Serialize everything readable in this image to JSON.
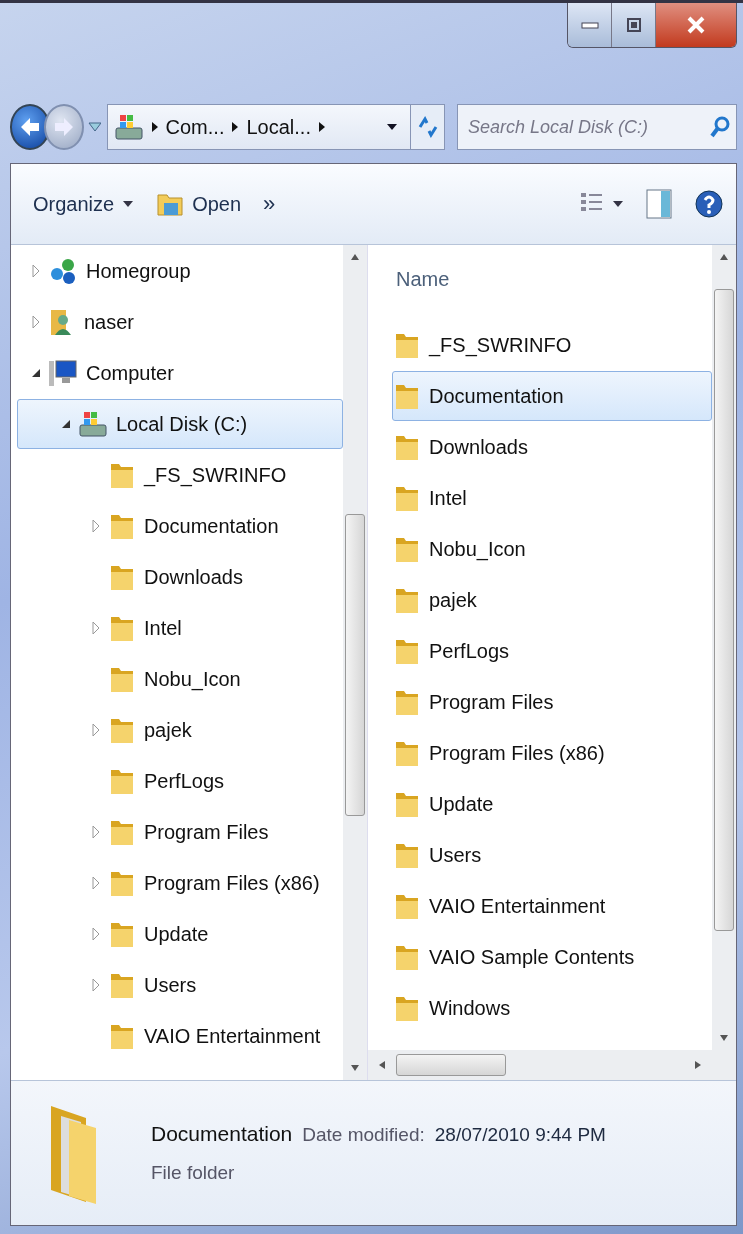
{
  "address_bar": {
    "crumbs": [
      "Com...",
      "Local..."
    ]
  },
  "search": {
    "placeholder": "Search Local Disk (C:)"
  },
  "toolbar": {
    "organize": "Organize",
    "open": "Open",
    "more": "»"
  },
  "tree": [
    {
      "name": "Homegroup",
      "kind": "homegroup",
      "expandable": true,
      "expanded": false,
      "selected": false
    },
    {
      "name": "naser",
      "kind": "user",
      "expandable": true,
      "expanded": false,
      "selected": false
    },
    {
      "name": "Computer",
      "kind": "computer",
      "expandable": true,
      "expanded": true,
      "selected": false,
      "children": [
        {
          "name": "Local Disk (C:)",
          "kind": "drive",
          "expandable": true,
          "expanded": true,
          "selected": true,
          "children": [
            {
              "name": "_FS_SWRINFO",
              "kind": "folder",
              "expandable": false,
              "expanded": false,
              "selected": false
            },
            {
              "name": "Documentation",
              "kind": "folder",
              "expandable": true,
              "expanded": false,
              "selected": false
            },
            {
              "name": "Downloads",
              "kind": "folder",
              "expandable": false,
              "expanded": false,
              "selected": false
            },
            {
              "name": "Intel",
              "kind": "folder",
              "expandable": true,
              "expanded": false,
              "selected": false
            },
            {
              "name": "Nobu_Icon",
              "kind": "folder",
              "expandable": false,
              "expanded": false,
              "selected": false
            },
            {
              "name": "pajek",
              "kind": "folder",
              "expandable": true,
              "expanded": false,
              "selected": false
            },
            {
              "name": "PerfLogs",
              "kind": "folder",
              "expandable": false,
              "expanded": false,
              "selected": false
            },
            {
              "name": "Program Files",
              "kind": "folder",
              "expandable": true,
              "expanded": false,
              "selected": false
            },
            {
              "name": "Program Files (x86)",
              "kind": "folder",
              "expandable": true,
              "expanded": false,
              "selected": false
            },
            {
              "name": "Update",
              "kind": "folder",
              "expandable": true,
              "expanded": false,
              "selected": false
            },
            {
              "name": "Users",
              "kind": "folder",
              "expandable": true,
              "expanded": false,
              "selected": false
            },
            {
              "name": "VAIO Entertainment",
              "kind": "folder",
              "expandable": false,
              "expanded": false,
              "selected": false
            }
          ]
        }
      ]
    }
  ],
  "file_list": {
    "column": "Name",
    "items": [
      {
        "name": "_FS_SWRINFO",
        "selected": false
      },
      {
        "name": "Documentation",
        "selected": true
      },
      {
        "name": "Downloads",
        "selected": false
      },
      {
        "name": "Intel",
        "selected": false
      },
      {
        "name": "Nobu_Icon",
        "selected": false
      },
      {
        "name": "pajek",
        "selected": false
      },
      {
        "name": "PerfLogs",
        "selected": false
      },
      {
        "name": "Program Files",
        "selected": false
      },
      {
        "name": "Program Files (x86)",
        "selected": false
      },
      {
        "name": "Update",
        "selected": false
      },
      {
        "name": "Users",
        "selected": false
      },
      {
        "name": "VAIO Entertainment",
        "selected": false
      },
      {
        "name": "VAIO Sample Contents",
        "selected": false
      },
      {
        "name": "Windows",
        "selected": false
      }
    ]
  },
  "details": {
    "name": "Documentation",
    "date_label": "Date modified:",
    "date": "28/07/2010 9:44 PM",
    "type": "File folder"
  }
}
